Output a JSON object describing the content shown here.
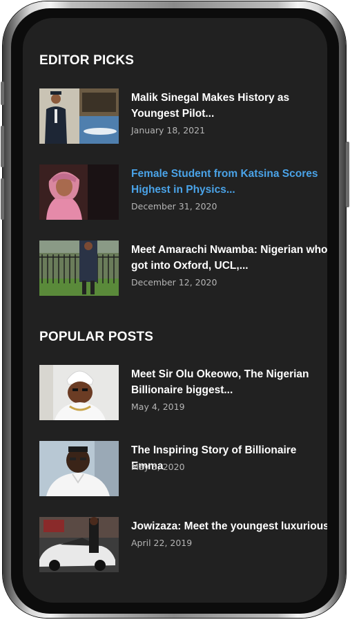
{
  "colors": {
    "screen_background": "#212121",
    "title_text": "#ffffff",
    "active_link": "#4aa3e8",
    "date_text": "#b5b5b5"
  },
  "editor_picks": {
    "heading": "EDITOR PICKS",
    "items": [
      {
        "title": "Malik Sinegal Makes History as Youngest Pilot...",
        "date": "January 18, 2021",
        "active": false
      },
      {
        "title": "Female Student from Katsina Scores Highest in Physics...",
        "date": "December 31, 2020",
        "active": true
      },
      {
        "title": "Meet Amarachi Nwamba: Nigerian who got into Oxford, UCL,...",
        "date": "December 12, 2020",
        "active": false
      }
    ]
  },
  "popular_posts": {
    "heading": "POPULAR POSTS",
    "items": [
      {
        "title": "Meet Sir Olu Okeowo, The Nigerian Billionaire biggest...",
        "date": "May 4, 2019"
      },
      {
        "title": "The Inspiring Story of Billionaire Emma",
        "date": "May 5, 2020"
      },
      {
        "title": "Jowizaza: Meet the youngest luxurious",
        "date": "April 22, 2019"
      }
    ]
  }
}
